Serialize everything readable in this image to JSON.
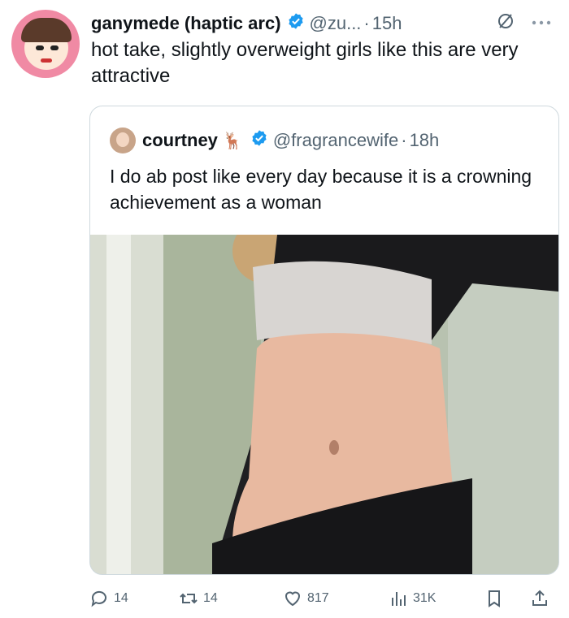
{
  "tweet": {
    "display_name": "ganymede (haptic arc)",
    "handle": "@zu...",
    "separator": "·",
    "time": "15h",
    "text": "hot take, slightly overweight girls like this are very attractive"
  },
  "quoted": {
    "display_name": "courtney",
    "handle": "@fragrancewife",
    "separator": "·",
    "time": "18h",
    "text": "I do ab post like every day because it is a crowning achievement as a woman",
    "deer_emoji": "🦌"
  },
  "actions": {
    "replies": "14",
    "retweets": "14",
    "likes": "817",
    "views": "31K"
  },
  "colors": {
    "verified": "#1d9bf0",
    "muted": "#536471",
    "border": "#cfd9de"
  },
  "icons": [
    "verified-badge-icon",
    "mute-icon",
    "more-icon",
    "reply-icon",
    "retweet-icon",
    "like-icon",
    "views-icon",
    "bookmark-icon",
    "share-icon"
  ]
}
